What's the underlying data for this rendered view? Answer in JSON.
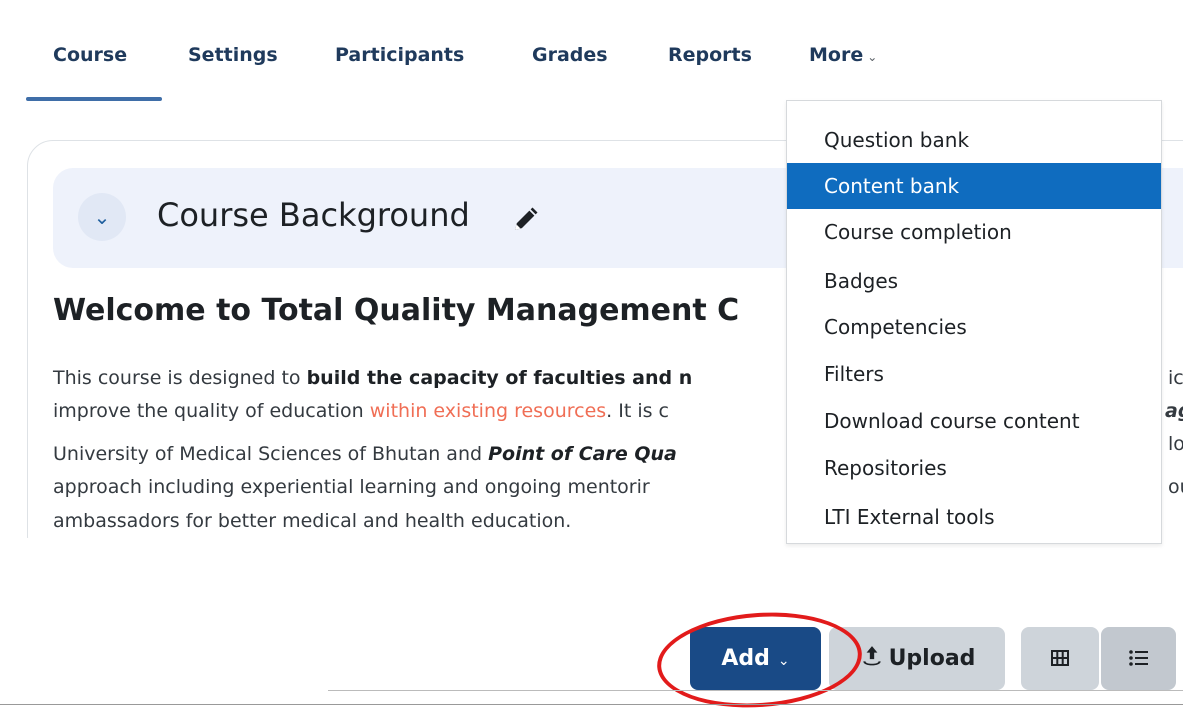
{
  "nav": {
    "tabs": [
      "Course",
      "Settings",
      "Participants",
      "Grades",
      "Reports"
    ],
    "more_label": "More",
    "more_chevron": "⌄"
  },
  "section": {
    "collapse_chevron": "⌄",
    "title": "Course Background",
    "pencil_icon": "pencil-icon"
  },
  "content": {
    "heading": "Welcome to Total Quality Management C",
    "line1_plain": "This course is designed to ",
    "line1_bold": "build the capacity of faculties and n",
    "line2_plain": "improve the quality of education ",
    "line2_red": "within existing resources",
    "line2_tail": ". It is c",
    "line3_plain": "University of Medical Sciences of Bhutan and ",
    "line3_bold": "Point of Care Qua",
    "line4": "approach including experiential learning and ongoing mentorir",
    "line5": "ambassadors for better medical and health education.",
    "right_fragments": [
      "ic",
      "ag",
      "lo",
      "ou"
    ]
  },
  "more_menu": {
    "items": [
      "Question bank",
      "Content bank",
      "Course completion",
      "Badges",
      "Competencies",
      "Filters",
      "Download course content",
      "Repositories",
      "LTI External tools"
    ],
    "active_index": 1
  },
  "toolbar": {
    "add_label": "Add",
    "add_chevron": "⌄",
    "upload_label": "Upload",
    "upload_icon": "upload-icon",
    "grid_icon": "grid-view-icon",
    "list_icon": "list-view-icon"
  },
  "colors": {
    "accent": "#0f6cbf",
    "add_button": "#194a86",
    "highlight_circle": "#e21b1b",
    "link_red": "#f06e55"
  }
}
